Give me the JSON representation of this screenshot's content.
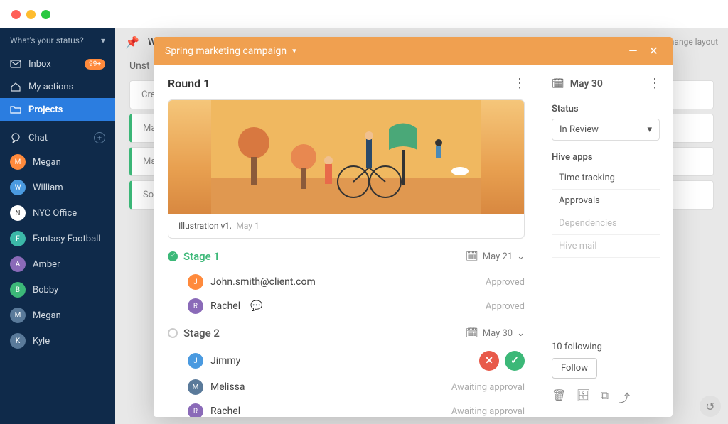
{
  "sidebar": {
    "status_label": "What's your status?",
    "inbox_label": "Inbox",
    "inbox_badge": "99+",
    "my_actions_label": "My actions",
    "projects_label": "Projects",
    "chat_label": "Chat",
    "users": [
      {
        "name": "Megan"
      },
      {
        "name": "William"
      },
      {
        "name": "NYC Office"
      },
      {
        "name": "Fantasy Football"
      },
      {
        "name": "Amber"
      },
      {
        "name": "Bobby"
      },
      {
        "name": "Megan"
      },
      {
        "name": "Kyle"
      }
    ]
  },
  "main_bg": {
    "pinned_label": "W",
    "change_layout_label": "nange layout",
    "col_unstarted": "Unst",
    "create_placeholder": "Crea",
    "cards": [
      {
        "label": "Ma"
      },
      {
        "label": "Ma"
      },
      {
        "label": "So"
      }
    ]
  },
  "modal": {
    "title": "Spring marketing campaign",
    "round_title": "Round 1",
    "illustration": {
      "caption": "Illustration v1,",
      "date": "May 1"
    },
    "stages": [
      {
        "name": "Stage 1",
        "done": true,
        "date": "May 21",
        "approvers": [
          {
            "name": "John.smith@client.com",
            "status": "Approved",
            "has_comment": false
          },
          {
            "name": "Rachel",
            "status": "Approved",
            "has_comment": true
          }
        ]
      },
      {
        "name": "Stage 2",
        "done": false,
        "date": "May 30",
        "approvers": [
          {
            "name": "Jimmy",
            "status": "actions"
          },
          {
            "name": "Melissa",
            "status": "Awaiting approval"
          },
          {
            "name": "Rachel",
            "status": "Awaiting approval"
          }
        ]
      }
    ],
    "right": {
      "date": "May 30",
      "status_label": "Status",
      "status_value": "In Review",
      "apps_label": "Hive apps",
      "apps": [
        {
          "label": "Time tracking",
          "muted": false
        },
        {
          "label": "Approvals",
          "muted": false
        },
        {
          "label": "Dependencies",
          "muted": true
        },
        {
          "label": "Hive mail",
          "muted": true
        }
      ],
      "following_text": "10 following",
      "follow_btn": "Follow"
    }
  }
}
